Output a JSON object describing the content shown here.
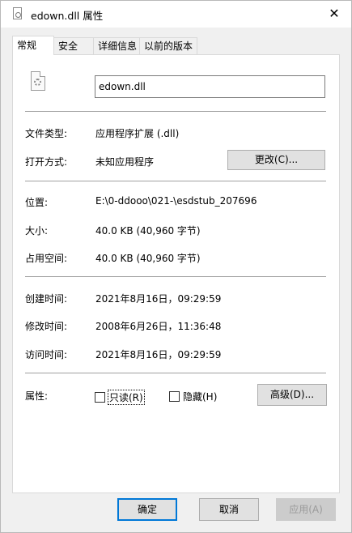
{
  "window": {
    "title": "edown.dll 属性",
    "close_glyph": "✕"
  },
  "tabs": [
    {
      "label": "常规",
      "active": true
    },
    {
      "label": "安全",
      "active": false
    },
    {
      "label": "详细信息",
      "active": false
    },
    {
      "label": "以前的版本",
      "active": false
    }
  ],
  "general": {
    "file_name": "edown.dll",
    "type_label": "文件类型:",
    "type_value": "应用程序扩展 (.dll)",
    "opens_label": "打开方式:",
    "opens_value": "未知应用程序",
    "change_button": "更改(C)...",
    "location_label": "位置:",
    "location_value": "E:\\0-ddooo\\021-\\esdstub_207696",
    "size_label": "大小:",
    "size_value": "40.0 KB (40,960 字节)",
    "disk_label": "占用空间:",
    "disk_value": "40.0 KB (40,960 字节)",
    "created_label": "创建时间:",
    "created_value": "2021年8月16日，09:29:59",
    "modified_label": "修改时间:",
    "modified_value": "2008年6月26日，11:36:48",
    "accessed_label": "访问时间:",
    "accessed_value": "2021年8月16日，09:29:59",
    "attrs_label": "属性:",
    "readonly_label": "只读(R)",
    "hidden_label": "隐藏(H)",
    "advanced_button": "高级(D)..."
  },
  "footer": {
    "ok": "确定",
    "cancel": "取消",
    "apply": "应用(A)"
  },
  "colors": {
    "accent": "#0078d7"
  }
}
